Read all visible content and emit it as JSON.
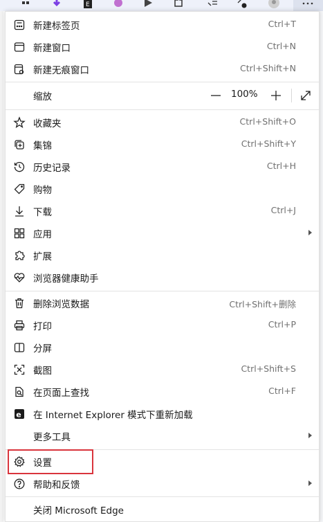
{
  "menu": {
    "items": {
      "new_tab": {
        "label": "新建标签页",
        "shortcut": "Ctrl+T"
      },
      "new_window": {
        "label": "新建窗口",
        "shortcut": "Ctrl+N"
      },
      "new_inprivate": {
        "label": "新建无痕窗口",
        "shortcut": "Ctrl+Shift+N"
      },
      "zoom": {
        "label": "缩放",
        "value": "100%",
        "minus": "—",
        "plus": "+"
      },
      "favorites": {
        "label": "收藏夹",
        "shortcut": "Ctrl+Shift+O"
      },
      "collections": {
        "label": "集锦",
        "shortcut": "Ctrl+Shift+Y"
      },
      "history": {
        "label": "历史记录",
        "shortcut": "Ctrl+H"
      },
      "shopping": {
        "label": "购物",
        "shortcut": ""
      },
      "downloads": {
        "label": "下载",
        "shortcut": "Ctrl+J"
      },
      "apps": {
        "label": "应用",
        "shortcut": ""
      },
      "extensions": {
        "label": "扩展",
        "shortcut": ""
      },
      "browser_essentials": {
        "label": "浏览器健康助手",
        "shortcut": ""
      },
      "clear_data": {
        "label": "删除浏览数据",
        "shortcut": "Ctrl+Shift+删除"
      },
      "print": {
        "label": "打印",
        "shortcut": "Ctrl+P"
      },
      "split_screen": {
        "label": "分屏",
        "shortcut": ""
      },
      "screenshot": {
        "label": "截图",
        "shortcut": "Ctrl+Shift+S"
      },
      "find": {
        "label": "在页面上查找",
        "shortcut": "Ctrl+F"
      },
      "ie_mode": {
        "label": "在 Internet Explorer 模式下重新加载",
        "shortcut": ""
      },
      "more_tools": {
        "label": "更多工具",
        "shortcut": ""
      },
      "settings": {
        "label": "设置",
        "shortcut": ""
      },
      "help": {
        "label": "帮助和反馈",
        "shortcut": ""
      },
      "close": {
        "label": "关闭 Microsoft Edge",
        "shortcut": ""
      }
    }
  },
  "colors": {
    "highlight": "#d9343c",
    "separator": "#e3e3e3"
  }
}
